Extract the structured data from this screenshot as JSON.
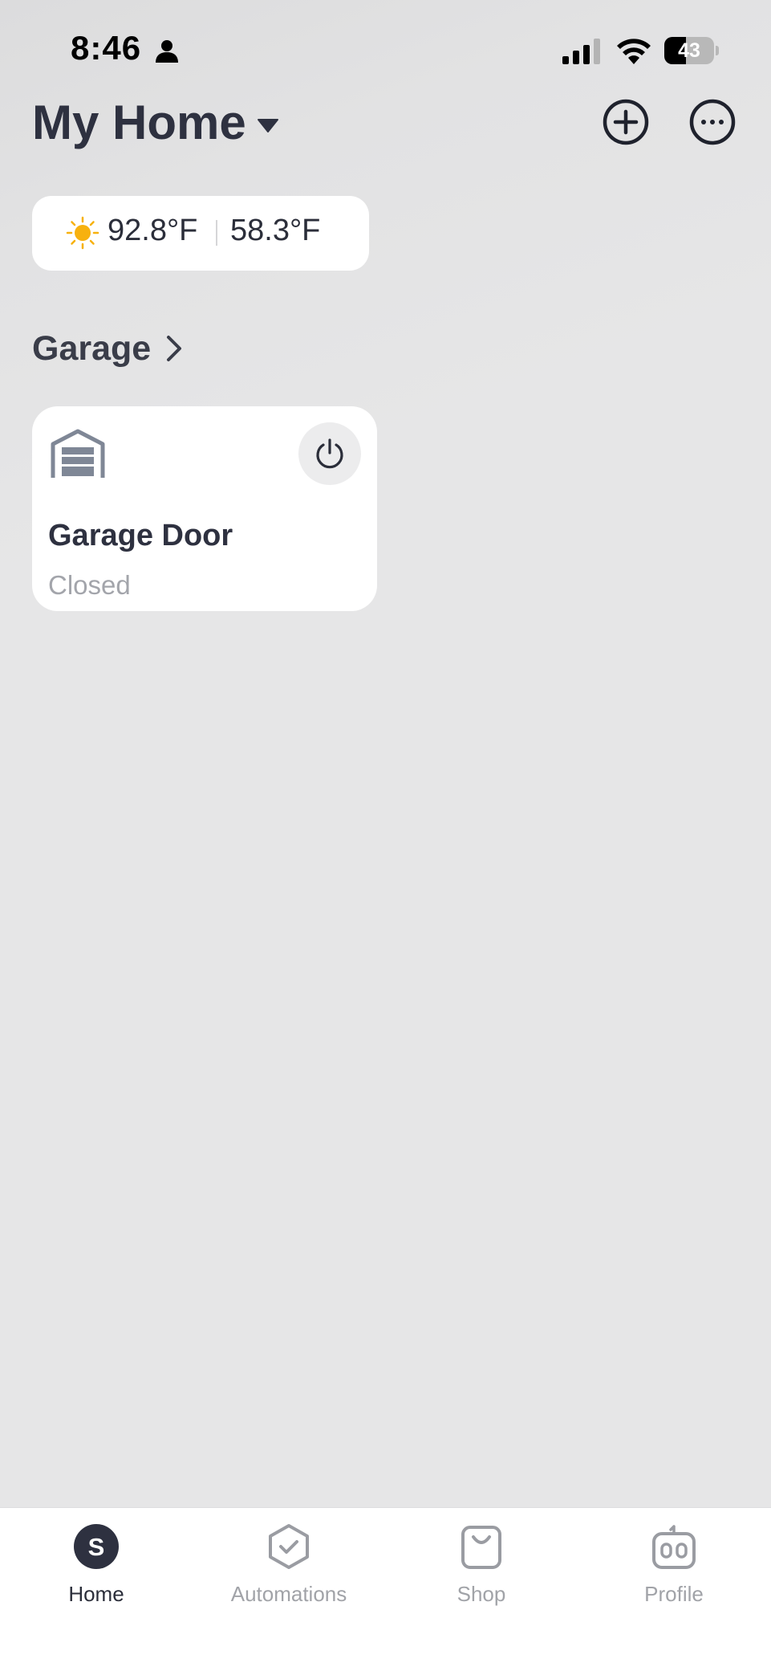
{
  "status_bar": {
    "time": "8:46",
    "battery_percent": "43",
    "battery_level": 0.43
  },
  "header": {
    "title": "My Home"
  },
  "weather": {
    "high": "92.8°F",
    "low": "58.3°F",
    "icon": "sun-icon"
  },
  "room": {
    "title": "Garage"
  },
  "device": {
    "name": "Garage Door",
    "status": "Closed",
    "icon": "garage-icon"
  },
  "tab_bar": {
    "tabs": [
      {
        "label": "Home",
        "icon": "home-s-icon",
        "active": true
      },
      {
        "label": "Automations",
        "icon": "automations-icon",
        "active": false
      },
      {
        "label": "Shop",
        "icon": "shop-bag-icon",
        "active": false
      },
      {
        "label": "Profile",
        "icon": "robot-profile-icon",
        "active": false
      }
    ]
  },
  "colors": {
    "accent_dark": "#2e3140",
    "sun": "#f7b10e",
    "muted": "#a1a3a8",
    "background": "#e6e6e7"
  }
}
